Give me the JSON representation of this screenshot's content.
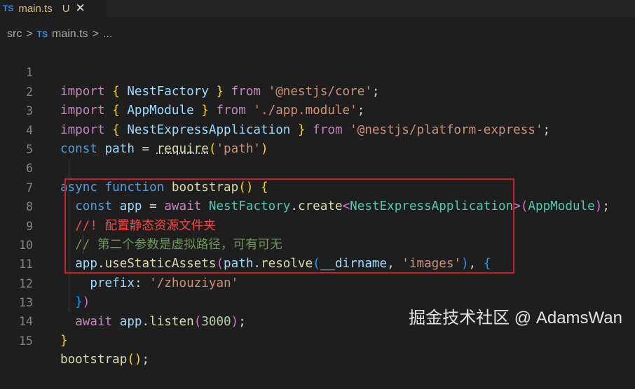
{
  "tab": {
    "badge": "TS",
    "name": "main.ts",
    "status": "U",
    "close_glyph": "✕"
  },
  "breadcrumb": {
    "folder": "src",
    "sep": ">",
    "ts_badge": "TS",
    "file": "main.ts",
    "sep2": ">",
    "more": "..."
  },
  "editor": {
    "line_numbers": [
      "1",
      "2",
      "3",
      "4",
      "5",
      "6",
      "7",
      "8",
      "9",
      "10",
      "11",
      "12",
      "13",
      "14",
      "15"
    ],
    "l1": {
      "kw": "import",
      "b_open": "{",
      "name": "NestFactory",
      "b_close": "}",
      "from": "from",
      "str": "'@nestjs/core'",
      "semi": ";"
    },
    "l2": {
      "kw": "import",
      "b_open": "{",
      "name": "AppModule",
      "b_close": "}",
      "from": "from",
      "str": "'./app.module'",
      "semi": ";"
    },
    "l3": {
      "kw": "import",
      "b_open": "{",
      "name": "NestExpressApplication",
      "b_close": "}",
      "from": "from",
      "str": "'@nestjs/platform-express'",
      "semi": ";"
    },
    "l4": {
      "kw": "const",
      "var": "path",
      "eq": "=",
      "fn": "require",
      "p_open": "(",
      "str": "'path'",
      "p_close": ")"
    },
    "l6": {
      "async": "async",
      "function": "function",
      "name": "bootstrap",
      "parens": "()",
      "brace": "{"
    },
    "l7": {
      "kw": "const",
      "var": "app",
      "eq": "=",
      "await": "await",
      "cls": "NestFactory",
      "dot": ".",
      "fn": "create",
      "lt": "<",
      "type": "NestExpressApplication",
      "gt": ">",
      "p_open": "(",
      "arg": "AppModule",
      "p_close": ")",
      "semi": ";"
    },
    "l8": {
      "comment": "//! 配置静态资源文件夹"
    },
    "l9": {
      "comment": "// 第二个参数是虚拟路径，可有可无"
    },
    "l10": {
      "var": "app",
      "dot": ".",
      "fn": "useStaticAssets",
      "p_open": "(",
      "var2": "path",
      "dot2": ".",
      "fn2": "resolve",
      "p2_open": "(",
      "arg": "__dirname",
      "comma": ",",
      "str": "'images'",
      "p2_close": ")",
      "comma2": ",",
      "brace": "{"
    },
    "l11": {
      "key": "prefix",
      "colon": ":",
      "str": "'/zhouziyan'"
    },
    "l12": {
      "brace": "}",
      "paren": ")"
    },
    "l13": {
      "await": "await",
      "var": "app",
      "dot": ".",
      "fn": "listen",
      "p_open": "(",
      "num": "3000",
      "p_close": ")",
      "semi": ";"
    },
    "l14": {
      "brace": "}"
    },
    "l15": {
      "fn": "bootstrap",
      "parens": "()",
      "semi": ";"
    }
  },
  "watermark": "掘金技术社区 @ AdamsWan"
}
